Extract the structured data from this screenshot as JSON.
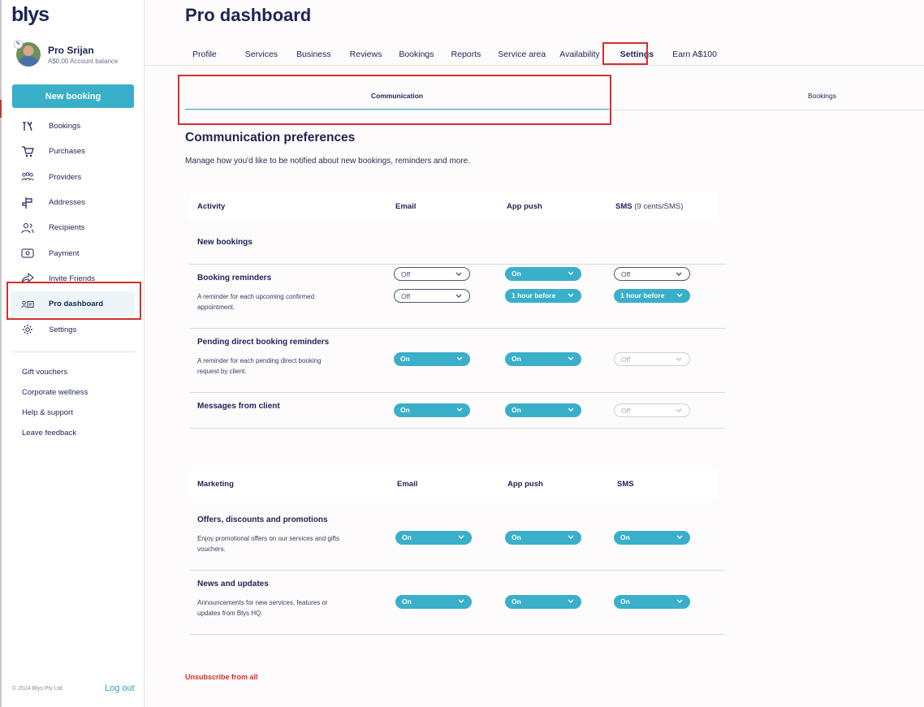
{
  "app": {
    "logo": "blys"
  },
  "profile": {
    "name": "Pro Srijan",
    "balance": "A$0.00 Account balance"
  },
  "sidebar": {
    "new_booking": "New booking",
    "items": [
      {
        "label": "Bookings",
        "icon": "map-pin-icon"
      },
      {
        "label": "Purchases",
        "icon": "cart-icon"
      },
      {
        "label": "Providers",
        "icon": "people-icon"
      },
      {
        "label": "Addresses",
        "icon": "signpost-icon"
      },
      {
        "label": "Recipients",
        "icon": "users-icon"
      },
      {
        "label": "Payment",
        "icon": "wallet-icon"
      },
      {
        "label": "Invite Friends",
        "icon": "share-icon"
      },
      {
        "label": "Pro dashboard",
        "icon": "id-card-icon"
      },
      {
        "label": "Settings",
        "icon": "gear-icon"
      }
    ],
    "links": [
      "Gift vouchers",
      "Corporate wellness",
      "Help & support",
      "Leave feedback"
    ],
    "copyright": "© 2024 Blys Pty Ltd",
    "logout": "Log out"
  },
  "page": {
    "title": "Pro dashboard"
  },
  "tabs": [
    "Profile",
    "Services",
    "Business",
    "Reviews",
    "Bookings",
    "Reports",
    "Service area",
    "Availability",
    "Settings",
    "Earn A$100"
  ],
  "subtabs": [
    "Communication",
    "Bookings"
  ],
  "comm": {
    "title": "Communication preferences",
    "description": "Manage how you'd like to be notified about new bookings, reminders and more."
  },
  "activity": {
    "headers": {
      "col1": "Activity",
      "email": "Email",
      "push": "App push",
      "sms": "SMS",
      "sms_note": "(9 cents/SMS)"
    },
    "rows": [
      {
        "title": "New bookings",
        "desc": "",
        "email": "Off",
        "push": "On",
        "sms": "Off"
      },
      {
        "title": "Booking reminders",
        "desc": "A reminder for each upcoming confirmed appointment.",
        "email": "Off",
        "push": "1 hour before",
        "sms": "1 hour before"
      },
      {
        "title": "Pending direct booking reminders",
        "desc": "A reminder for each pending direct booking request by client.",
        "email": "On",
        "push": "On",
        "sms": "Off"
      },
      {
        "title": "Messages from client",
        "desc": "",
        "email": "On",
        "push": "On",
        "sms": "Off"
      }
    ]
  },
  "marketing": {
    "headers": {
      "col1": "Marketing",
      "email": "Email",
      "push": "App push",
      "sms": "SMS"
    },
    "rows": [
      {
        "title": "Offers, discounts and promotions",
        "desc": "Enjoy promotional offers on our services and gifts vouchers.",
        "email": "On",
        "push": "On",
        "sms": "On"
      },
      {
        "title": "News and updates",
        "desc": "Announcements for new services, features or updates from Blys HQ.",
        "email": "On",
        "push": "On",
        "sms": "On"
      }
    ]
  },
  "unsubscribe": "Unsubscribe from all",
  "colors": {
    "accent": "#3aafc9",
    "navy": "#1f2354",
    "highlight": "#d32f2f"
  }
}
